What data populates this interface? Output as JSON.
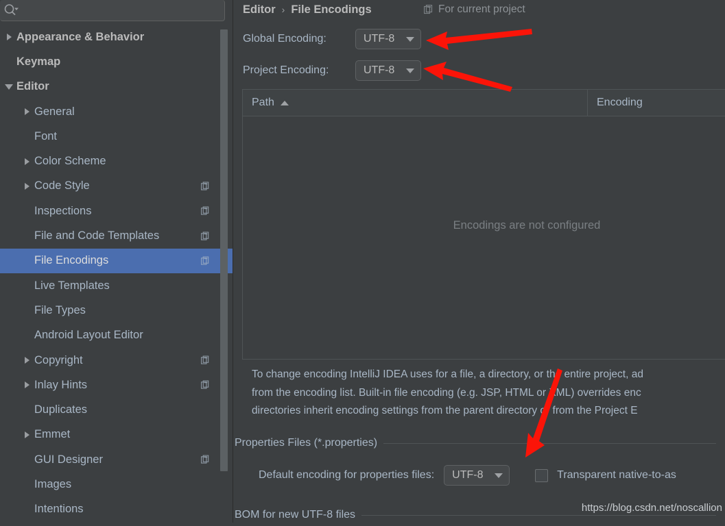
{
  "search": {
    "placeholder": "",
    "value": "",
    "icon": "search-icon"
  },
  "sidebar": {
    "items": [
      {
        "label": "Appearance & Behavior",
        "level": 0,
        "expander": "right",
        "badge": false,
        "selected": false
      },
      {
        "label": "Keymap",
        "level": 0,
        "expander": "none",
        "badge": false,
        "selected": false
      },
      {
        "label": "Editor",
        "level": 0,
        "expander": "down",
        "badge": false,
        "selected": false
      },
      {
        "label": "General",
        "level": 1,
        "expander": "right",
        "badge": false,
        "selected": false
      },
      {
        "label": "Font",
        "level": 1,
        "expander": "none",
        "badge": false,
        "selected": false
      },
      {
        "label": "Color Scheme",
        "level": 1,
        "expander": "right",
        "badge": false,
        "selected": false
      },
      {
        "label": "Code Style",
        "level": 1,
        "expander": "right",
        "badge": true,
        "selected": false
      },
      {
        "label": "Inspections",
        "level": 1,
        "expander": "none",
        "badge": true,
        "selected": false
      },
      {
        "label": "File and Code Templates",
        "level": 1,
        "expander": "none",
        "badge": true,
        "selected": false
      },
      {
        "label": "File Encodings",
        "level": 1,
        "expander": "none",
        "badge": true,
        "selected": true
      },
      {
        "label": "Live Templates",
        "level": 1,
        "expander": "none",
        "badge": false,
        "selected": false
      },
      {
        "label": "File Types",
        "level": 1,
        "expander": "none",
        "badge": false,
        "selected": false
      },
      {
        "label": "Android Layout Editor",
        "level": 1,
        "expander": "none",
        "badge": false,
        "selected": false
      },
      {
        "label": "Copyright",
        "level": 1,
        "expander": "right",
        "badge": true,
        "selected": false
      },
      {
        "label": "Inlay Hints",
        "level": 1,
        "expander": "right",
        "badge": true,
        "selected": false
      },
      {
        "label": "Duplicates",
        "level": 1,
        "expander": "none",
        "badge": false,
        "selected": false
      },
      {
        "label": "Emmet",
        "level": 1,
        "expander": "right",
        "badge": false,
        "selected": false
      },
      {
        "label": "GUI Designer",
        "level": 1,
        "expander": "none",
        "badge": true,
        "selected": false
      },
      {
        "label": "Images",
        "level": 1,
        "expander": "none",
        "badge": false,
        "selected": false
      },
      {
        "label": "Intentions",
        "level": 1,
        "expander": "none",
        "badge": false,
        "selected": false
      }
    ]
  },
  "header": {
    "breadcrumb_parent": "Editor",
    "breadcrumb_sep": "›",
    "breadcrumb_current": "File Encodings",
    "for_current_project": "For current project",
    "for_current_project_icon": "copy-project-icon"
  },
  "encodings": {
    "global_label": "Global Encoding:",
    "global_value": "UTF-8",
    "project_label": "Project Encoding:",
    "project_value": "UTF-8"
  },
  "table": {
    "columns": [
      "Path",
      "Encoding"
    ],
    "sort_column": "Path",
    "sort_direction": "ascending",
    "rows": [],
    "empty_message": "Encodings are not configured"
  },
  "description": {
    "line1": "To change encoding IntelliJ IDEA uses for a file, a directory, or the entire project, ad",
    "line2": "from the encoding list. Built-in file encoding (e.g. JSP, HTML or XML) overrides enc",
    "line3": "directories inherit encoding settings from the parent directory or from the Project E"
  },
  "properties_section": {
    "title": "Properties Files (*.properties)",
    "default_encoding_label": "Default encoding for properties files:",
    "default_encoding_value": "UTF-8",
    "transparent_checkbox_label": "Transparent native-to-as",
    "transparent_checked": false
  },
  "bom_section": {
    "title": "BOM for new UTF-8 files"
  },
  "watermark": {
    "text": "https://blog.csdn.net/noscallion"
  },
  "annotations": {
    "arrow_color": "#fb1408",
    "arrow1_target": "global-encoding-combo",
    "arrow2_target": "project-encoding-combo",
    "arrow3_target": "properties-default-encoding-combo"
  },
  "colors": {
    "background": "#3c3f41",
    "selection": "#4b6eaf",
    "text": "#a9b7c6",
    "border": "#4f5456",
    "muted_text": "#7a7f83"
  }
}
